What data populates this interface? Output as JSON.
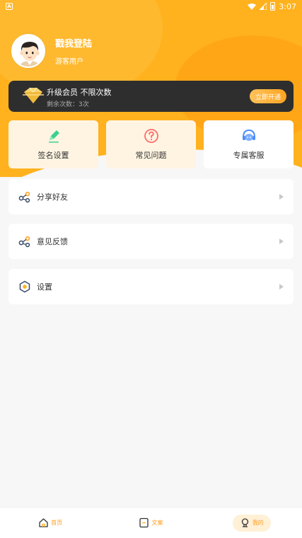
{
  "status_bar": {
    "app_indicator": "A",
    "time": "3:07"
  },
  "profile": {
    "login_title": "戳我登陆",
    "user_type": "游客用户"
  },
  "vip": {
    "title": "升级会员 不限次数",
    "remaining": "剩余次数：3次",
    "button": "立即开通"
  },
  "quick_actions": [
    {
      "label": "签名设置",
      "icon": "pencil-icon"
    },
    {
      "label": "常见问题",
      "icon": "question-icon"
    },
    {
      "label": "专属客服",
      "icon": "headset-icon"
    }
  ],
  "menu": [
    {
      "label": "分享好友",
      "icon": "share-icon"
    },
    {
      "label": "意见反馈",
      "icon": "feedback-icon"
    },
    {
      "label": "设置",
      "icon": "settings-icon"
    }
  ],
  "bottom_nav": [
    {
      "label": "首页",
      "icon": "home-icon",
      "active": false
    },
    {
      "label": "文案",
      "icon": "document-icon",
      "active": false
    },
    {
      "label": "我的",
      "icon": "profile-icon",
      "active": true
    }
  ],
  "colors": {
    "accent": "#ffb21e",
    "accent_text": "#ff9d1e",
    "vip_card": "#2e2e2e",
    "background": "#f7f7f7"
  }
}
